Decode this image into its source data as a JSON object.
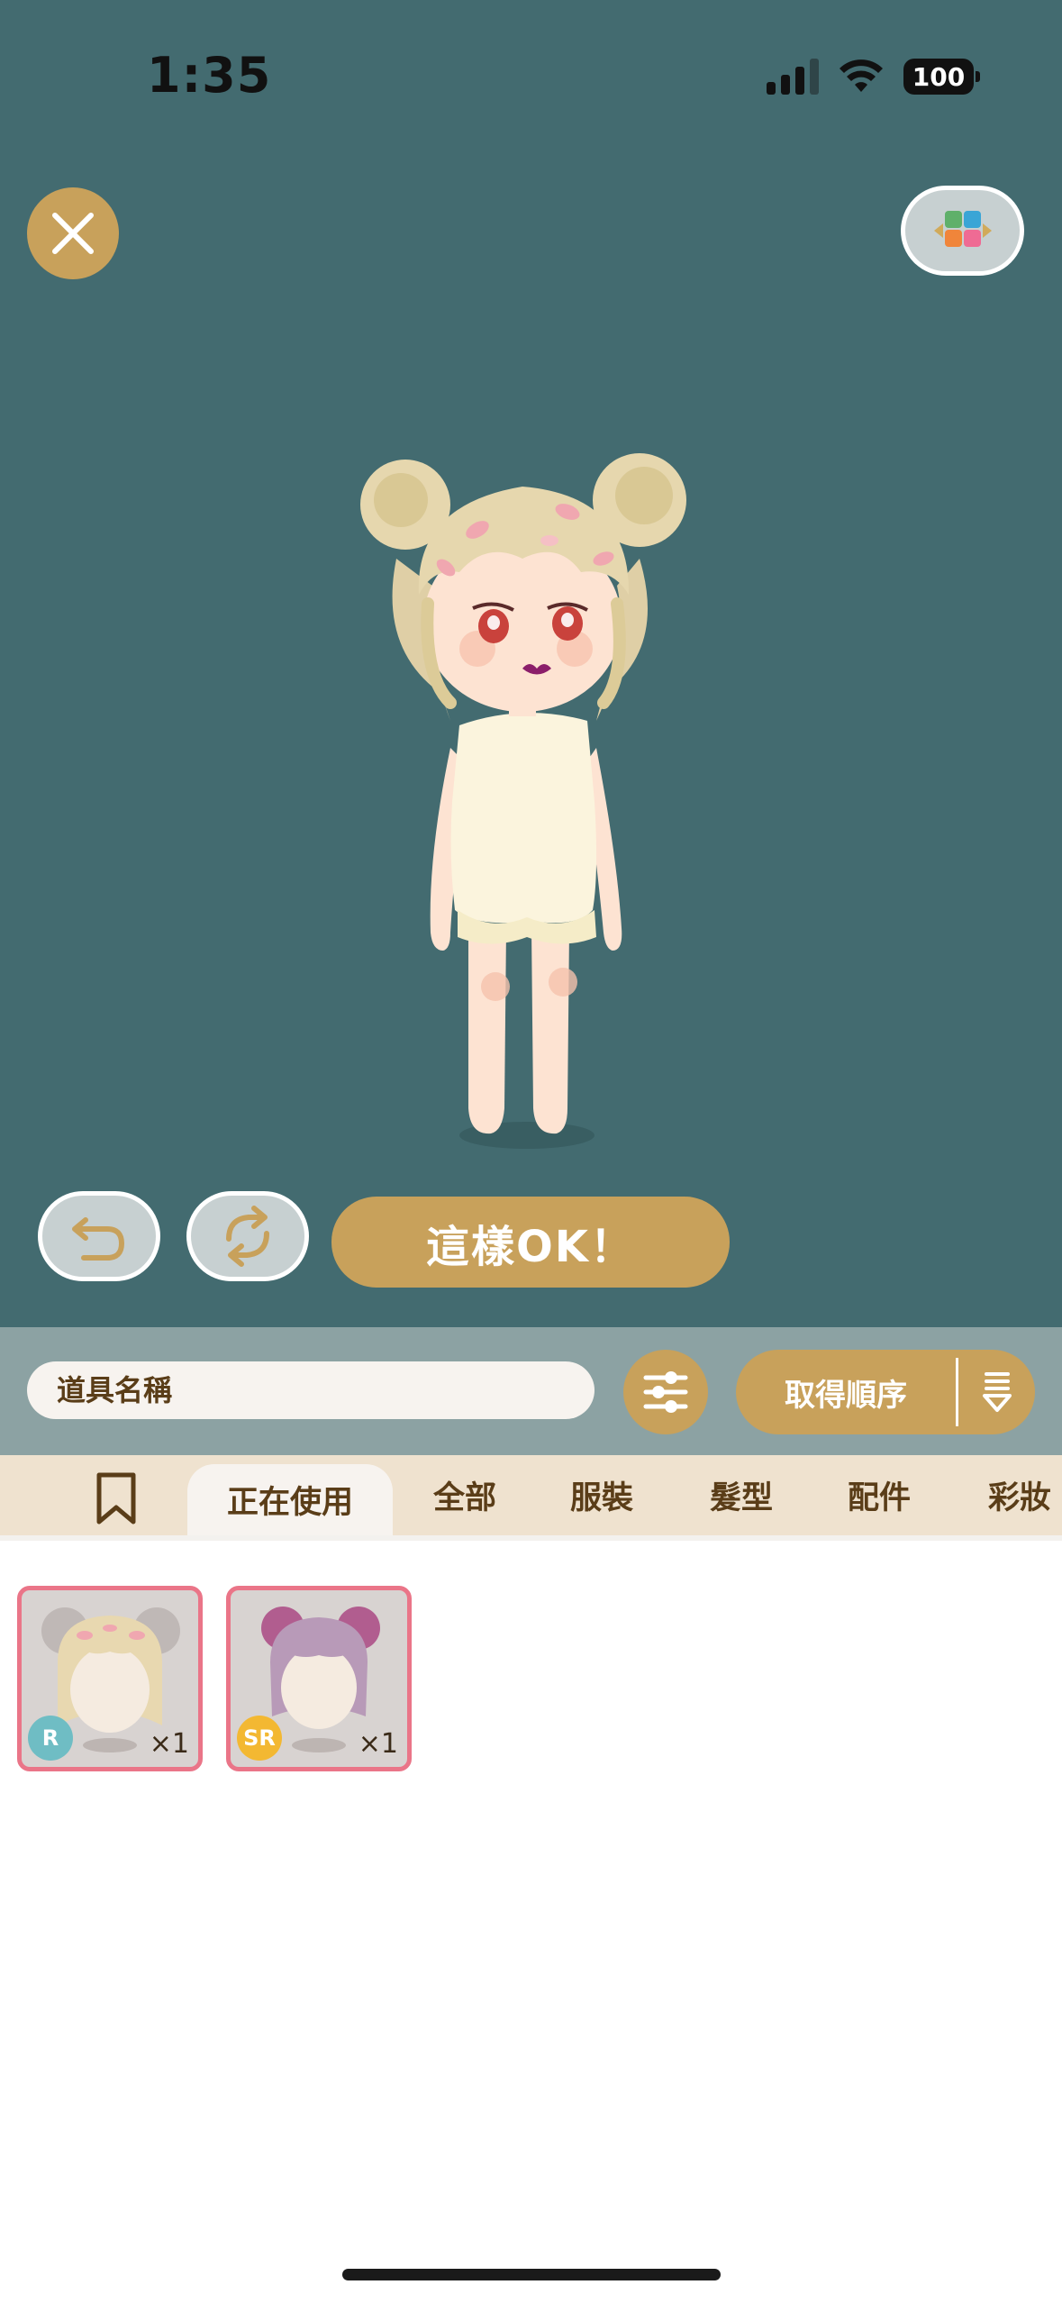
{
  "status_bar": {
    "time": "1:35",
    "battery": "100"
  },
  "stage": {
    "background_color": "#436b70",
    "ok_button_label": "這樣OK！"
  },
  "toolbar": {
    "search_placeholder": "道具名稱",
    "sort_label": "取得順序"
  },
  "tabs": [
    {
      "label": "正在使用",
      "active": true
    },
    {
      "label": "全部",
      "active": false
    },
    {
      "label": "服裝",
      "active": false
    },
    {
      "label": "髮型",
      "active": false
    },
    {
      "label": "配件",
      "active": false
    },
    {
      "label": "彩妝",
      "active": false
    }
  ],
  "items": [
    {
      "rarity": "R",
      "quantity": "×1",
      "hair_color": "#e8d8b0"
    },
    {
      "rarity": "SR",
      "quantity": "×1",
      "hair_color": "#b89ab8"
    }
  ],
  "colors": {
    "accent_gold": "#c8a15b",
    "toolbar_bg": "#8ca2a3",
    "tab_bar_bg": "#efe2cf",
    "tab_text": "#5a3d18",
    "item_border": "#ea7588"
  }
}
